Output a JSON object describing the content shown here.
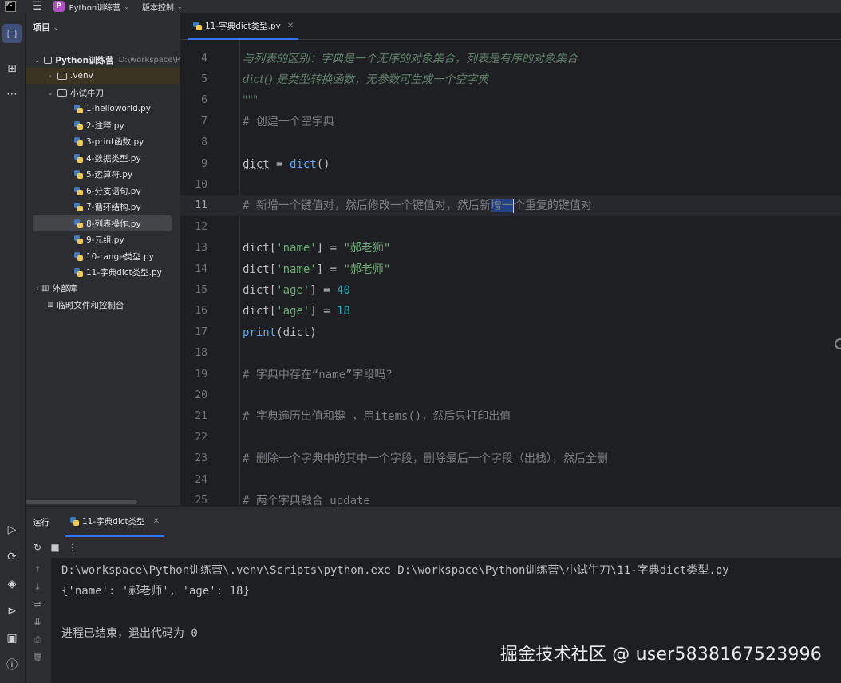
{
  "topbar": {
    "logo_text": "PC",
    "project_badge": "P",
    "project_name": "Python训练营",
    "vcs_label": "版本控制"
  },
  "project_panel": {
    "title": "项目",
    "root": {
      "name": "Python训练营",
      "path": "D:\\workspace\\P"
    },
    "items": [
      {
        "label": ".venv"
      },
      {
        "label": "小试牛刀"
      },
      {
        "label": "1-helloworld.py"
      },
      {
        "label": "2-注释.py"
      },
      {
        "label": "3-print函数.py"
      },
      {
        "label": "4-数据类型.py"
      },
      {
        "label": "5-运算符.py"
      },
      {
        "label": "6-分支语句.py"
      },
      {
        "label": "7-循环结构.py"
      },
      {
        "label": "8-列表操作.py"
      },
      {
        "label": "9-元组.py"
      },
      {
        "label": "10-range类型.py"
      },
      {
        "label": "11-字典dict类型.py"
      },
      {
        "label": "外部库"
      },
      {
        "label": "临时文件和控制台"
      }
    ]
  },
  "editor": {
    "tab": "11-字典dict类型.py",
    "lines": {
      "l4": {
        "n": "4",
        "t": "与列表的区别：字典是一个无序的对象集合，列表是有序的对象集合"
      },
      "l5": {
        "n": "5",
        "t": "dict() 是类型转换函数，无参数可生成一个空字典"
      },
      "l6": {
        "n": "6",
        "t": "\"\"\""
      },
      "l7": {
        "n": "7",
        "t": "# 创建一个空字典"
      },
      "l8": {
        "n": "8"
      },
      "l9": {
        "n": "9",
        "a": "dict",
        "b": " = ",
        "c": "dict",
        "d": "()"
      },
      "l10": {
        "n": "10"
      },
      "l11": {
        "n": "11",
        "a": "# 新增一个键值对，然后修改一个键值对，然后新",
        "sel": "增一",
        "b": "个重复的键值对"
      },
      "l12": {
        "n": "12"
      },
      "l13": {
        "n": "13",
        "a": "dict[",
        "k": "'name'",
        "b": "] = ",
        "v": "\"郝老狮\""
      },
      "l14": {
        "n": "14",
        "a": "dict[",
        "k": "'name'",
        "b": "] = ",
        "v": "\"郝老师\""
      },
      "l15": {
        "n": "15",
        "a": "dict[",
        "k": "'age'",
        "b": "] = ",
        "v": "40"
      },
      "l16": {
        "n": "16",
        "a": "dict[",
        "k": "'age'",
        "b": "] = ",
        "v": "18"
      },
      "l17": {
        "n": "17",
        "a": "print",
        "b": "(dict)"
      },
      "l18": {
        "n": "18"
      },
      "l19": {
        "n": "19",
        "t": "# 字典中存在“name”字段吗?"
      },
      "l20": {
        "n": "20"
      },
      "l21": {
        "n": "21",
        "t": "# 字典遍历出值和键 ，用items()，然后只打印出值"
      },
      "l22": {
        "n": "22"
      },
      "l23": {
        "n": "23",
        "t": "# 删除一个字典中的其中一个字段，删除最后一个字段（出栈），然后全删"
      },
      "l24": {
        "n": "24"
      },
      "l25": {
        "n": "25",
        "t": "# 两个字典融合 update"
      }
    }
  },
  "run_panel": {
    "label": "运行",
    "tab": "11-字典dict类型",
    "output": [
      "D:\\workspace\\Python训练营\\.venv\\Scripts\\python.exe D:\\workspace\\Python训练营\\小试牛刀\\11-字典dict类型.py",
      "{'name': '郝老师', 'age': 18}",
      "进程已结束，退出代码为 0"
    ]
  },
  "watermark": "掘金技术社区 @ user5838167523996",
  "colors": {
    "accent": "#3574f0",
    "comment": "#7a7e85",
    "string": "#6aab73",
    "number": "#2aacb8",
    "builtin": "#56a8f5",
    "selection": "#214283"
  }
}
